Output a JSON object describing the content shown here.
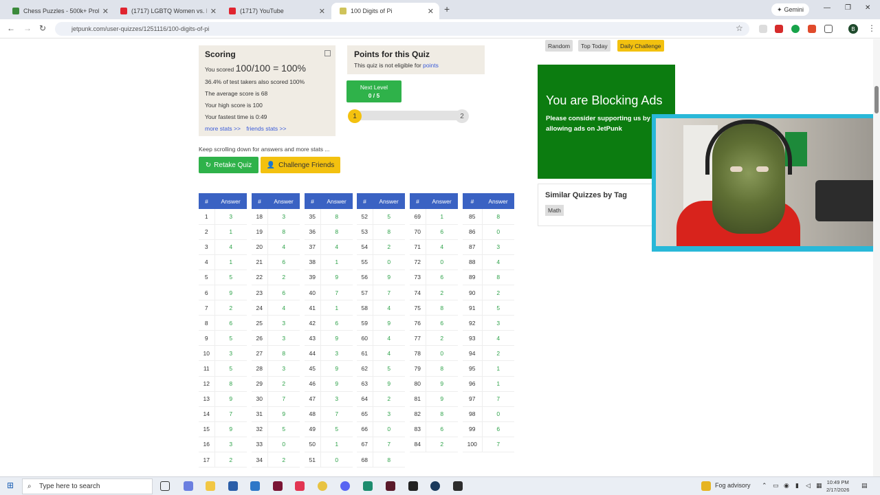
{
  "browser": {
    "tabs": [
      {
        "title": "Chess Puzzles - 500k+ Problems",
        "favicon_color": "#3b8a3b"
      },
      {
        "title": "(1717) LGBTQ Women vs. Former",
        "favicon_color": "#e0242f"
      },
      {
        "title": "(1717) YouTube",
        "favicon_color": "#e0242f"
      },
      {
        "title": "100 Digits of Pi",
        "favicon_color": "#cfc35a"
      }
    ],
    "new_tab": "+",
    "gemini_label": "Gemini",
    "url": "jetpunk.com/user-quizzes/1251116/100-digits-of-pi",
    "profile_initial": "B"
  },
  "scoring": {
    "title": "Scoring",
    "you_scored_label": "You scored",
    "score": "100/100 = 100%",
    "takers": "36.4% of test takers also scored 100%",
    "average": "The average score is 68",
    "high": "Your high score is 100",
    "fastest": "Your fastest time is 0:49",
    "more_stats": "more stats >>",
    "friends_stats": "friends stats >>"
  },
  "points": {
    "title": "Points for this Quiz",
    "text": "This quiz is not eligible for",
    "link": "points"
  },
  "level": {
    "next_label": "Next Level",
    "progress_text": "0 / 5",
    "current": "1",
    "next": "2",
    "progress": 0
  },
  "keep_scrolling": "Keep scrolling down for answers and more stats ...",
  "buttons": {
    "retake": "Retake Quiz",
    "challenge": "Challenge Friends"
  },
  "answers": {
    "col_num": "#",
    "col_answer": "Answer",
    "columns": [
      [
        [
          "1",
          "3"
        ],
        [
          "2",
          "1"
        ],
        [
          "3",
          "4"
        ],
        [
          "4",
          "1"
        ],
        [
          "5",
          "5"
        ],
        [
          "6",
          "9"
        ],
        [
          "7",
          "2"
        ],
        [
          "8",
          "6"
        ],
        [
          "9",
          "5"
        ],
        [
          "10",
          "3"
        ],
        [
          "11",
          "5"
        ],
        [
          "12",
          "8"
        ],
        [
          "13",
          "9"
        ],
        [
          "14",
          "7"
        ],
        [
          "15",
          "9"
        ],
        [
          "16",
          "3"
        ],
        [
          "17",
          "2"
        ]
      ],
      [
        [
          "18",
          "3"
        ],
        [
          "19",
          "8"
        ],
        [
          "20",
          "4"
        ],
        [
          "21",
          "6"
        ],
        [
          "22",
          "2"
        ],
        [
          "23",
          "6"
        ],
        [
          "24",
          "4"
        ],
        [
          "25",
          "3"
        ],
        [
          "26",
          "3"
        ],
        [
          "27",
          "8"
        ],
        [
          "28",
          "3"
        ],
        [
          "29",
          "2"
        ],
        [
          "30",
          "7"
        ],
        [
          "31",
          "9"
        ],
        [
          "32",
          "5"
        ],
        [
          "33",
          "0"
        ],
        [
          "34",
          "2"
        ]
      ],
      [
        [
          "35",
          "8"
        ],
        [
          "36",
          "8"
        ],
        [
          "37",
          "4"
        ],
        [
          "38",
          "1"
        ],
        [
          "39",
          "9"
        ],
        [
          "40",
          "7"
        ],
        [
          "41",
          "1"
        ],
        [
          "42",
          "6"
        ],
        [
          "43",
          "9"
        ],
        [
          "44",
          "3"
        ],
        [
          "45",
          "9"
        ],
        [
          "46",
          "9"
        ],
        [
          "47",
          "3"
        ],
        [
          "48",
          "7"
        ],
        [
          "49",
          "5"
        ],
        [
          "50",
          "1"
        ],
        [
          "51",
          "0"
        ]
      ],
      [
        [
          "52",
          "5"
        ],
        [
          "53",
          "8"
        ],
        [
          "54",
          "2"
        ],
        [
          "55",
          "0"
        ],
        [
          "56",
          "9"
        ],
        [
          "57",
          "7"
        ],
        [
          "58",
          "4"
        ],
        [
          "59",
          "9"
        ],
        [
          "60",
          "4"
        ],
        [
          "61",
          "4"
        ],
        [
          "62",
          "5"
        ],
        [
          "63",
          "9"
        ],
        [
          "64",
          "2"
        ],
        [
          "65",
          "3"
        ],
        [
          "66",
          "0"
        ],
        [
          "67",
          "7"
        ],
        [
          "68",
          "8"
        ]
      ],
      [
        [
          "69",
          "1"
        ],
        [
          "70",
          "6"
        ],
        [
          "71",
          "4"
        ],
        [
          "72",
          "0"
        ],
        [
          "73",
          "6"
        ],
        [
          "74",
          "2"
        ],
        [
          "75",
          "8"
        ],
        [
          "76",
          "6"
        ],
        [
          "77",
          "2"
        ],
        [
          "78",
          "0"
        ],
        [
          "79",
          "8"
        ],
        [
          "80",
          "9"
        ],
        [
          "81",
          "9"
        ],
        [
          "82",
          "8"
        ],
        [
          "83",
          "6"
        ],
        [
          "84",
          "2"
        ]
      ],
      [
        [
          "85",
          "8"
        ],
        [
          "86",
          "0"
        ],
        [
          "87",
          "3"
        ],
        [
          "88",
          "4"
        ],
        [
          "89",
          "8"
        ],
        [
          "90",
          "2"
        ],
        [
          "91",
          "5"
        ],
        [
          "92",
          "3"
        ],
        [
          "93",
          "4"
        ],
        [
          "94",
          "2"
        ],
        [
          "95",
          "1"
        ],
        [
          "96",
          "1"
        ],
        [
          "97",
          "7"
        ],
        [
          "98",
          "0"
        ],
        [
          "99",
          "6"
        ],
        [
          "100",
          "7"
        ]
      ]
    ]
  },
  "sidebar": {
    "tabs": [
      "Random",
      "Top Today",
      "Daily Challenge"
    ],
    "ad_title": "You are Blocking Ads",
    "ad_text": "Please consider supporting us by allowing ads on JetPunk",
    "similar_title": "Similar Quizzes by Tag",
    "tag": "Math"
  },
  "taskbar": {
    "search_placeholder": "Type here to search",
    "weather": "Fog advisory",
    "time": "10:49 PM",
    "date": "2/17/2026"
  }
}
